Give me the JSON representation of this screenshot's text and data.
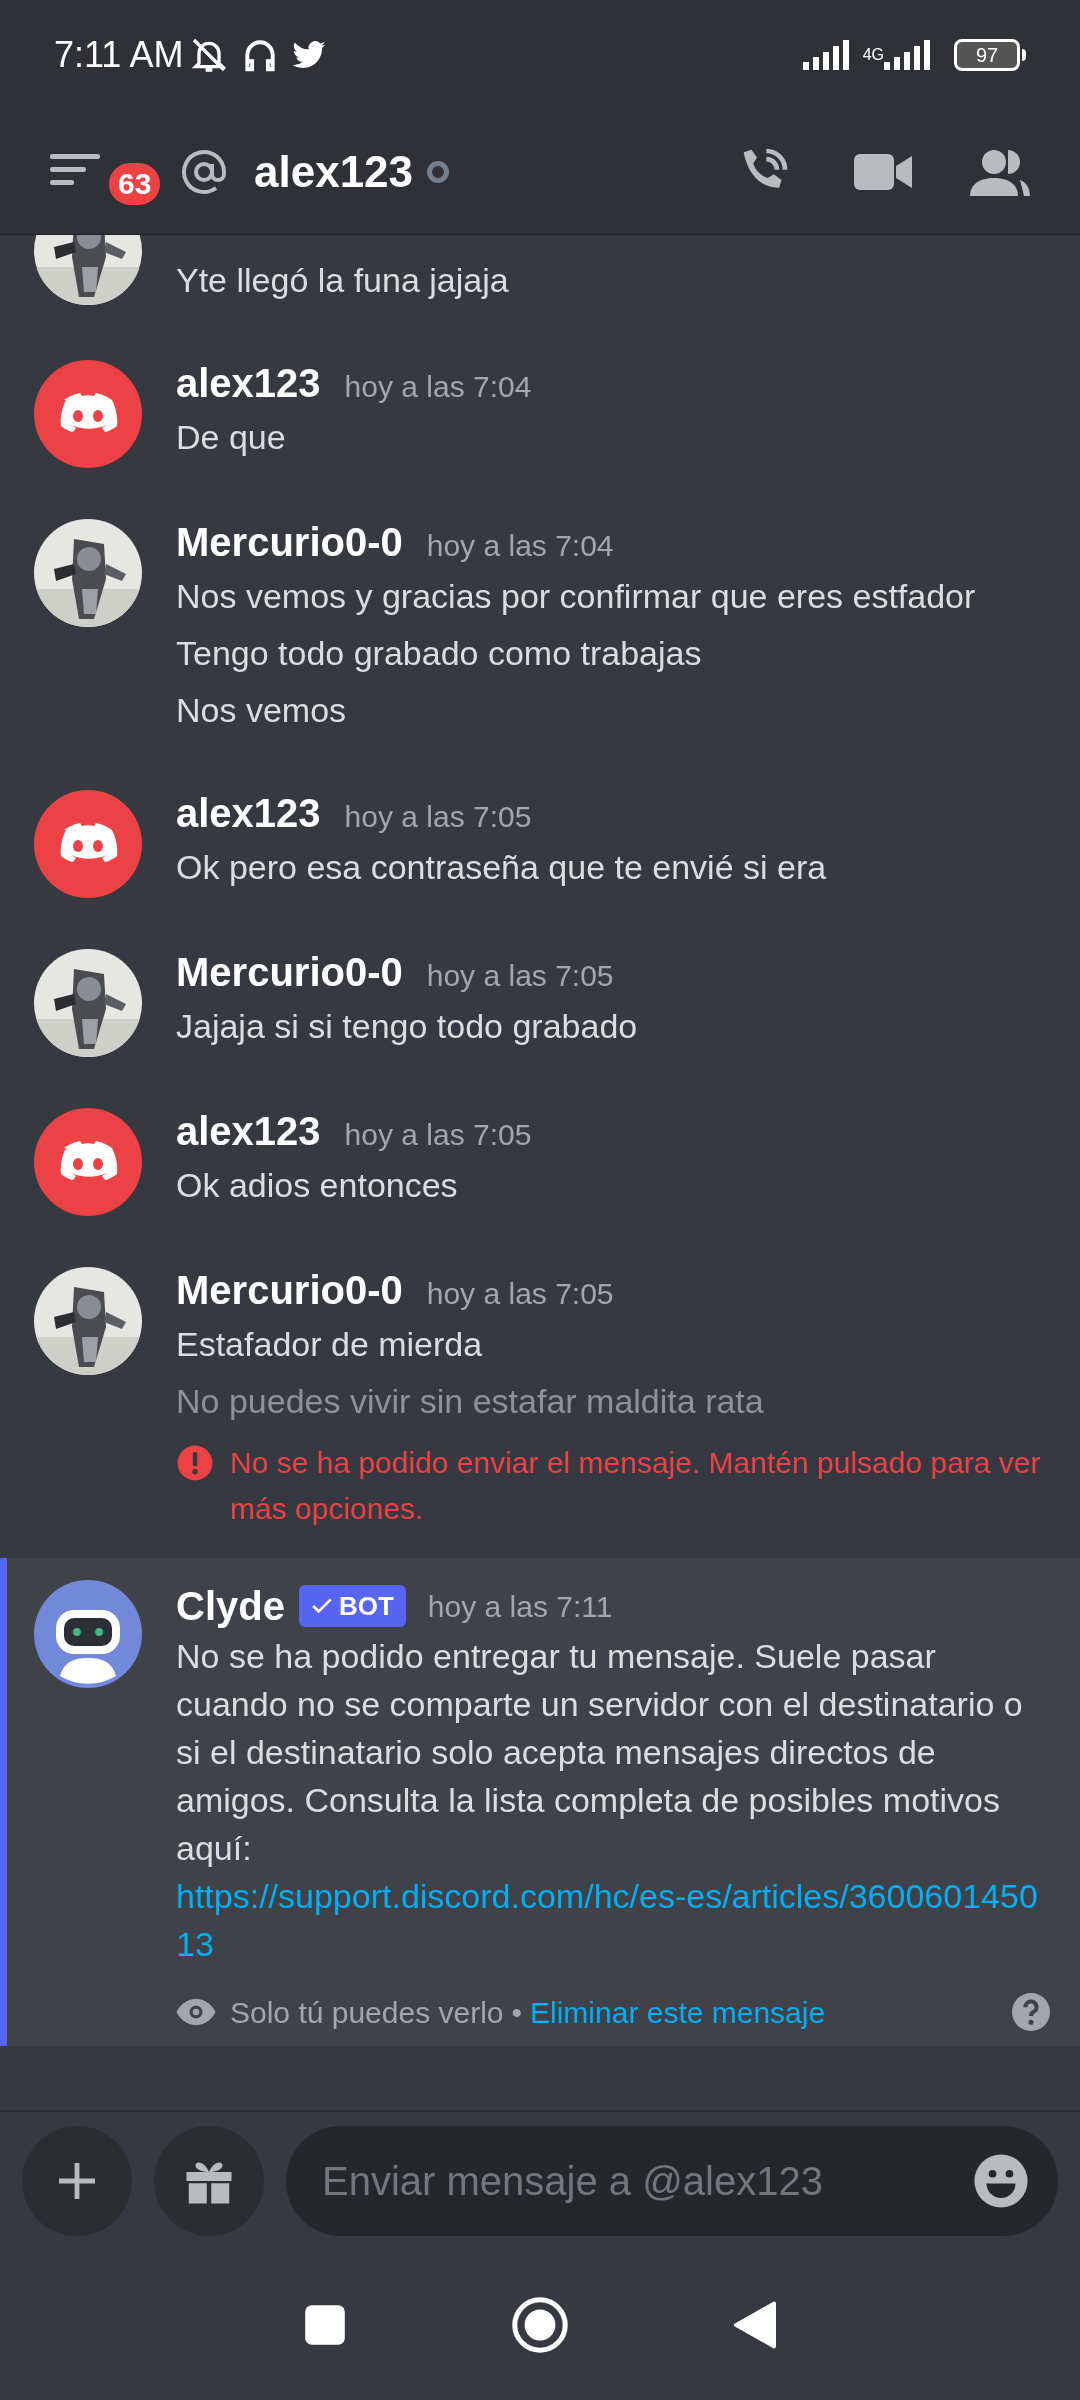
{
  "status_bar": {
    "time": "7:11 AM",
    "network": "4G",
    "battery": "97"
  },
  "header": {
    "badge": "63",
    "title": "alex123",
    "online": false
  },
  "messages": [
    {
      "lines": [
        {
          "text": "Yte llegó la funa jajaja",
          "failed": false
        }
      ]
    },
    {
      "author": "alex123",
      "kind": "discord",
      "time": "hoy a las 7:04",
      "lines": [
        {
          "text": "De que",
          "failed": false
        }
      ]
    },
    {
      "author": "Mercurio0-0",
      "time": "hoy a las 7:04",
      "lines": [
        {
          "text": "Nos vemos y gracias por confirmar que eres estfador",
          "failed": false
        },
        {
          "text": "Tengo todo grabado como trabajas",
          "failed": false
        },
        {
          "text": "Nos vemos",
          "failed": false
        }
      ]
    },
    {
      "author": "alex123",
      "kind": "discord",
      "time": "hoy a las 7:05",
      "lines": [
        {
          "text": "Ok pero esa contraseña que te envié si era",
          "failed": false
        }
      ]
    },
    {
      "author": "Mercurio0-0",
      "time": "hoy a las 7:05",
      "lines": [
        {
          "text": "Jajaja si si tengo todo grabado",
          "failed": false
        }
      ]
    },
    {
      "author": "alex123",
      "kind": "discord",
      "time": "hoy a las 7:05",
      "lines": [
        {
          "text": "Ok adios entonces",
          "failed": false
        }
      ]
    },
    {
      "author": "Mercurio0-0",
      "time": "hoy a las 7:05",
      "lines": [
        {
          "text": "Estafador de mierda",
          "failed": false
        },
        {
          "text": "No puedes vivir sin estafar maldita rata",
          "failed": true
        }
      ],
      "error": "No se ha podido enviar el mensaje. Mantén pulsado para ver más opciones."
    }
  ],
  "bot_message": {
    "author": "Clyde",
    "tag": "BOT",
    "time": "hoy a las 7:11",
    "text": "No se ha podido entregar tu mensaje. Suele pasar cuando no se comparte un servidor con el destinatario o si el destinatario solo acepta mensajes directos de amigos. Consulta la lista completa de posibles motivos aquí:",
    "link": "https://support.discord.com/hc/es-es/articles/360060145013",
    "note": "Solo tú puedes verlo",
    "separator": "•",
    "action": "Eliminar este mensaje"
  },
  "composer": {
    "placeholder": "Enviar mensaje a @alex123"
  }
}
